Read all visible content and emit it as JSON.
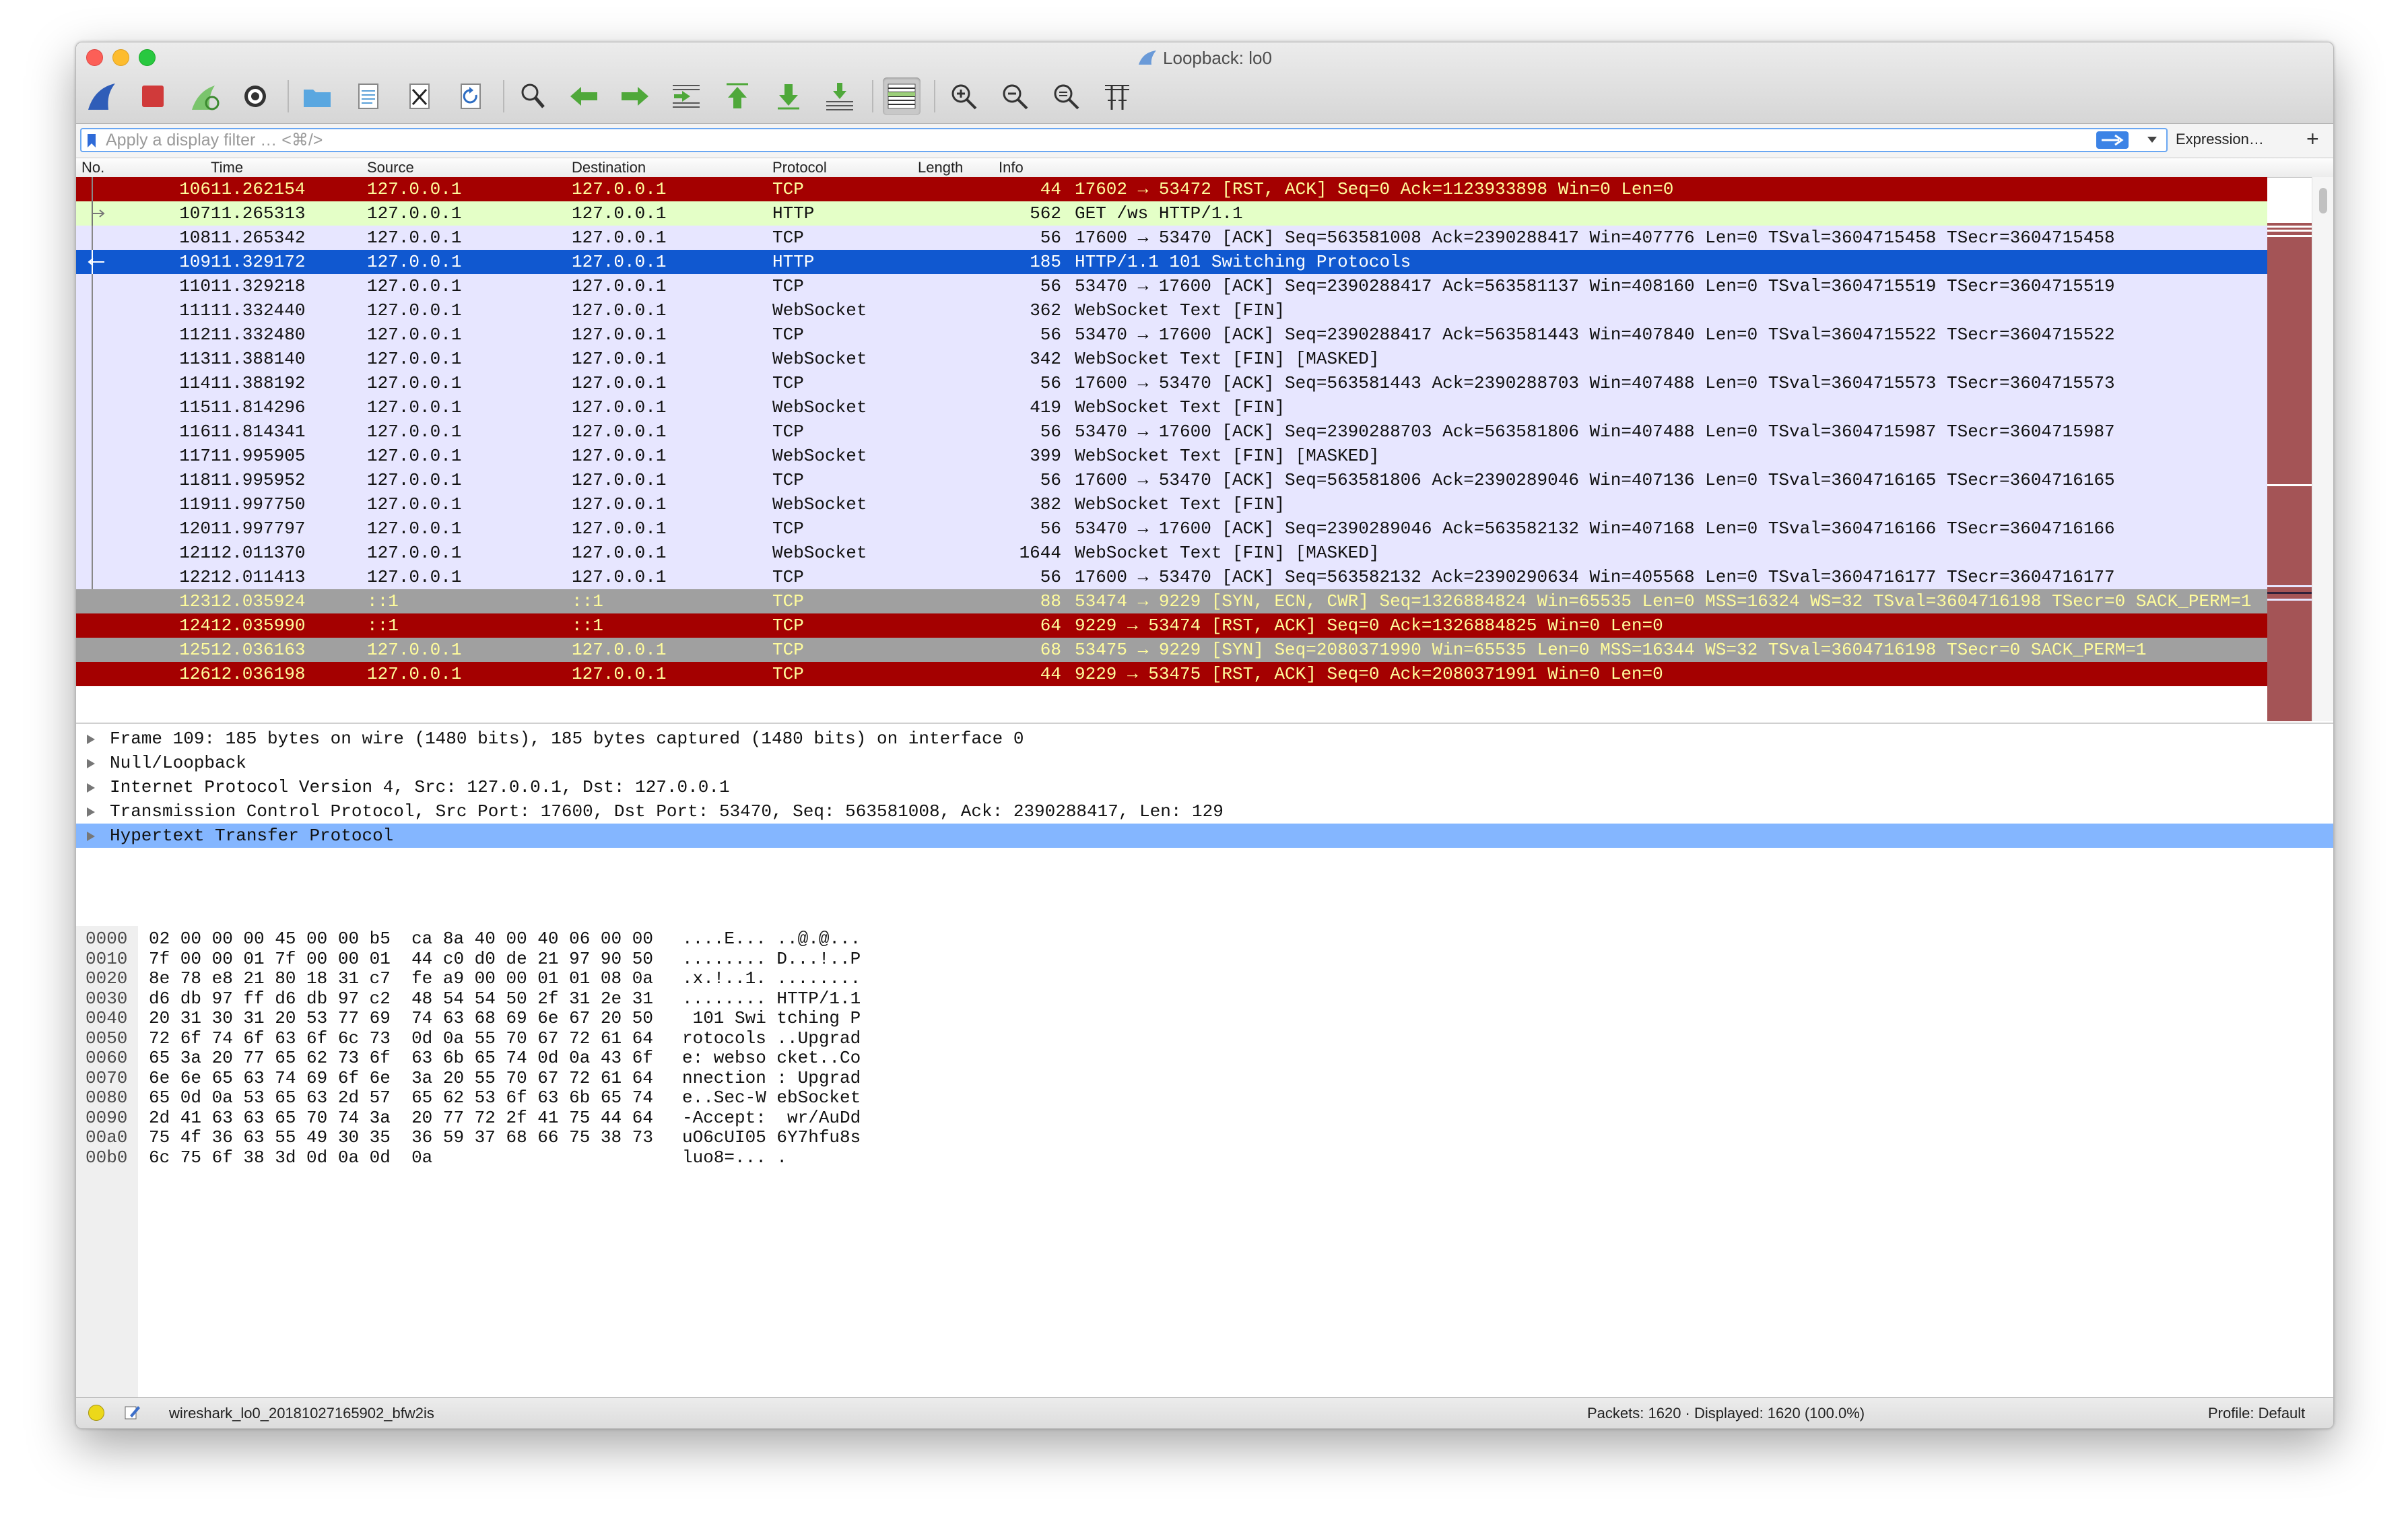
{
  "window": {
    "title": "Loopback: lo0"
  },
  "colors": {
    "row_tcp": "#e7e6ff",
    "row_http": "#e4ffc7",
    "row_selected": "#1058d0",
    "row_rst": "#a40000",
    "row_bad": "#a0a0a0",
    "text_yellow": "#fffc9c",
    "detail_selected": "#84b6ff"
  },
  "toolbar": {
    "buttons": [
      "shark-fin-icon",
      "stop-icon",
      "restart-icon",
      "options-gear-icon",
      "open-folder-icon",
      "save-file-icon",
      "close-file-icon",
      "reload-icon",
      "find-icon",
      "go-back-icon",
      "go-forward-icon",
      "go-to-packet-icon",
      "first-packet-icon",
      "last-packet-icon",
      "autoscroll-icon",
      "colorize-icon",
      "zoom-in-icon",
      "zoom-out-icon",
      "normal-size-icon",
      "resize-columns-icon"
    ]
  },
  "filter": {
    "placeholder": "Apply a display filter … <⌘/>",
    "expression_label": "Expression…",
    "plus_label": "+"
  },
  "columns": {
    "no": "No.",
    "time": "Time",
    "source": "Source",
    "destination": "Destination",
    "protocol": "Protocol",
    "length": "Length",
    "info": "Info"
  },
  "packets": [
    {
      "no": "106",
      "time": "11.262154",
      "src": "127.0.0.1",
      "dst": "127.0.0.1",
      "proto": "TCP",
      "len": "44",
      "info": "17602 → 53472 [RST, ACK] Seq=0 Ack=1123933898 Win=0 Len=0",
      "style": "rst"
    },
    {
      "no": "107",
      "time": "11.265313",
      "src": "127.0.0.1",
      "dst": "127.0.0.1",
      "proto": "HTTP",
      "len": "562",
      "info": "GET /ws HTTP/1.1",
      "style": "http"
    },
    {
      "no": "108",
      "time": "11.265342",
      "src": "127.0.0.1",
      "dst": "127.0.0.1",
      "proto": "TCP",
      "len": "56",
      "info": "17600 → 53470 [ACK] Seq=563581008 Ack=2390288417 Win=407776 Len=0 TSval=3604715458 TSecr=3604715458",
      "style": "tcp"
    },
    {
      "no": "109",
      "time": "11.329172",
      "src": "127.0.0.1",
      "dst": "127.0.0.1",
      "proto": "HTTP",
      "len": "185",
      "info": "HTTP/1.1 101 Switching Protocols",
      "style": "selected"
    },
    {
      "no": "110",
      "time": "11.329218",
      "src": "127.0.0.1",
      "dst": "127.0.0.1",
      "proto": "TCP",
      "len": "56",
      "info": "53470 → 17600 [ACK] Seq=2390288417 Ack=563581137 Win=408160 Len=0 TSval=3604715519 TSecr=3604715519",
      "style": "tcp"
    },
    {
      "no": "111",
      "time": "11.332440",
      "src": "127.0.0.1",
      "dst": "127.0.0.1",
      "proto": "WebSocket",
      "len": "362",
      "info": "WebSocket Text [FIN]",
      "style": "tcp"
    },
    {
      "no": "112",
      "time": "11.332480",
      "src": "127.0.0.1",
      "dst": "127.0.0.1",
      "proto": "TCP",
      "len": "56",
      "info": "53470 → 17600 [ACK] Seq=2390288417 Ack=563581443 Win=407840 Len=0 TSval=3604715522 TSecr=3604715522",
      "style": "tcp"
    },
    {
      "no": "113",
      "time": "11.388140",
      "src": "127.0.0.1",
      "dst": "127.0.0.1",
      "proto": "WebSocket",
      "len": "342",
      "info": "WebSocket Text [FIN] [MASKED]",
      "style": "tcp"
    },
    {
      "no": "114",
      "time": "11.388192",
      "src": "127.0.0.1",
      "dst": "127.0.0.1",
      "proto": "TCP",
      "len": "56",
      "info": "17600 → 53470 [ACK] Seq=563581443 Ack=2390288703 Win=407488 Len=0 TSval=3604715573 TSecr=3604715573",
      "style": "tcp"
    },
    {
      "no": "115",
      "time": "11.814296",
      "src": "127.0.0.1",
      "dst": "127.0.0.1",
      "proto": "WebSocket",
      "len": "419",
      "info": "WebSocket Text [FIN]",
      "style": "tcp"
    },
    {
      "no": "116",
      "time": "11.814341",
      "src": "127.0.0.1",
      "dst": "127.0.0.1",
      "proto": "TCP",
      "len": "56",
      "info": "53470 → 17600 [ACK] Seq=2390288703 Ack=563581806 Win=407488 Len=0 TSval=3604715987 TSecr=3604715987",
      "style": "tcp"
    },
    {
      "no": "117",
      "time": "11.995905",
      "src": "127.0.0.1",
      "dst": "127.0.0.1",
      "proto": "WebSocket",
      "len": "399",
      "info": "WebSocket Text [FIN] [MASKED]",
      "style": "tcp"
    },
    {
      "no": "118",
      "time": "11.995952",
      "src": "127.0.0.1",
      "dst": "127.0.0.1",
      "proto": "TCP",
      "len": "56",
      "info": "17600 → 53470 [ACK] Seq=563581806 Ack=2390289046 Win=407136 Len=0 TSval=3604716165 TSecr=3604716165",
      "style": "tcp"
    },
    {
      "no": "119",
      "time": "11.997750",
      "src": "127.0.0.1",
      "dst": "127.0.0.1",
      "proto": "WebSocket",
      "len": "382",
      "info": "WebSocket Text [FIN]",
      "style": "tcp"
    },
    {
      "no": "120",
      "time": "11.997797",
      "src": "127.0.0.1",
      "dst": "127.0.0.1",
      "proto": "TCP",
      "len": "56",
      "info": "53470 → 17600 [ACK] Seq=2390289046 Ack=563582132 Win=407168 Len=0 TSval=3604716166 TSecr=3604716166",
      "style": "tcp"
    },
    {
      "no": "121",
      "time": "12.011370",
      "src": "127.0.0.1",
      "dst": "127.0.0.1",
      "proto": "WebSocket",
      "len": "1644",
      "info": "WebSocket Text [FIN] [MASKED]",
      "style": "tcp"
    },
    {
      "no": "122",
      "time": "12.011413",
      "src": "127.0.0.1",
      "dst": "127.0.0.1",
      "proto": "TCP",
      "len": "56",
      "info": "17600 → 53470 [ACK] Seq=563582132 Ack=2390290634 Win=405568 Len=0 TSval=3604716177 TSecr=3604716177",
      "style": "tcp"
    },
    {
      "no": "123",
      "time": "12.035924",
      "src": "::1",
      "dst": "::1",
      "proto": "TCP",
      "len": "88",
      "info": "53474 → 9229 [SYN, ECN, CWR] Seq=1326884824 Win=65535 Len=0 MSS=16324 WS=32 TSval=3604716198 TSecr=0 SACK_PERM=1",
      "style": "bad"
    },
    {
      "no": "124",
      "time": "12.035990",
      "src": "::1",
      "dst": "::1",
      "proto": "TCP",
      "len": "64",
      "info": "9229 → 53474 [RST, ACK] Seq=0 Ack=1326884825 Win=0 Len=0",
      "style": "rst"
    },
    {
      "no": "125",
      "time": "12.036163",
      "src": "127.0.0.1",
      "dst": "127.0.0.1",
      "proto": "TCP",
      "len": "68",
      "info": "53475 → 9229 [SYN] Seq=2080371990 Win=65535 Len=0 MSS=16344 WS=32 TSval=3604716198 TSecr=0 SACK_PERM=1",
      "style": "bad"
    },
    {
      "no": "126",
      "time": "12.036198",
      "src": "127.0.0.1",
      "dst": "127.0.0.1",
      "proto": "TCP",
      "len": "44",
      "info": "9229 → 53475 [RST, ACK] Seq=0 Ack=2080371991 Win=0 Len=0",
      "style": "rst"
    }
  ],
  "details": [
    "Frame 109: 185 bytes on wire (1480 bits), 185 bytes captured (1480 bits) on interface 0",
    "Null/Loopback",
    "Internet Protocol Version 4, Src: 127.0.0.1, Dst: 127.0.0.1",
    "Transmission Control Protocol, Src Port: 17600, Dst Port: 53470, Seq: 563581008, Ack: 2390288417, Len: 129",
    "Hypertext Transfer Protocol"
  ],
  "details_selected": 4,
  "bytes": [
    {
      "off": "0000",
      "hex": "02 00 00 00 45 00 00 b5  ca 8a 40 00 40 06 00 00",
      "ascii": "....E... ..@.@..."
    },
    {
      "off": "0010",
      "hex": "7f 00 00 01 7f 00 00 01  44 c0 d0 de 21 97 90 50",
      "ascii": "........ D...!..P"
    },
    {
      "off": "0020",
      "hex": "8e 78 e8 21 80 18 31 c7  fe a9 00 00 01 01 08 0a",
      "ascii": ".x.!..1. ........"
    },
    {
      "off": "0030",
      "hex": "d6 db 97 ff d6 db 97 c2  48 54 54 50 2f 31 2e 31",
      "ascii": "........ HTTP/1.1"
    },
    {
      "off": "0040",
      "hex": "20 31 30 31 20 53 77 69  74 63 68 69 6e 67 20 50",
      "ascii": " 101 Swi tching P"
    },
    {
      "off": "0050",
      "hex": "72 6f 74 6f 63 6f 6c 73  0d 0a 55 70 67 72 61 64",
      "ascii": "rotocols ..Upgrad"
    },
    {
      "off": "0060",
      "hex": "65 3a 20 77 65 62 73 6f  63 6b 65 74 0d 0a 43 6f",
      "ascii": "e: webso cket..Co"
    },
    {
      "off": "0070",
      "hex": "6e 6e 65 63 74 69 6f 6e  3a 20 55 70 67 72 61 64",
      "ascii": "nnection : Upgrad"
    },
    {
      "off": "0080",
      "hex": "65 0d 0a 53 65 63 2d 57  65 62 53 6f 63 6b 65 74",
      "ascii": "e..Sec-W ebSocket"
    },
    {
      "off": "0090",
      "hex": "2d 41 63 63 65 70 74 3a  20 77 72 2f 41 75 44 64",
      "ascii": "-Accept:  wr/AuDd"
    },
    {
      "off": "00a0",
      "hex": "75 4f 36 63 55 49 30 35  36 59 37 68 66 75 38 73",
      "ascii": "uO6cUI05 6Y7hfu8s"
    },
    {
      "off": "00b0",
      "hex": "6c 75 6f 38 3d 0d 0a 0d  0a",
      "ascii": "luo8=... ."
    }
  ],
  "status": {
    "filename": "wireshark_lo0_20181027165902_bfw2is",
    "packets": "Packets: 1620 · Displayed: 1620 (100.0%)",
    "profile": "Profile: Default"
  }
}
